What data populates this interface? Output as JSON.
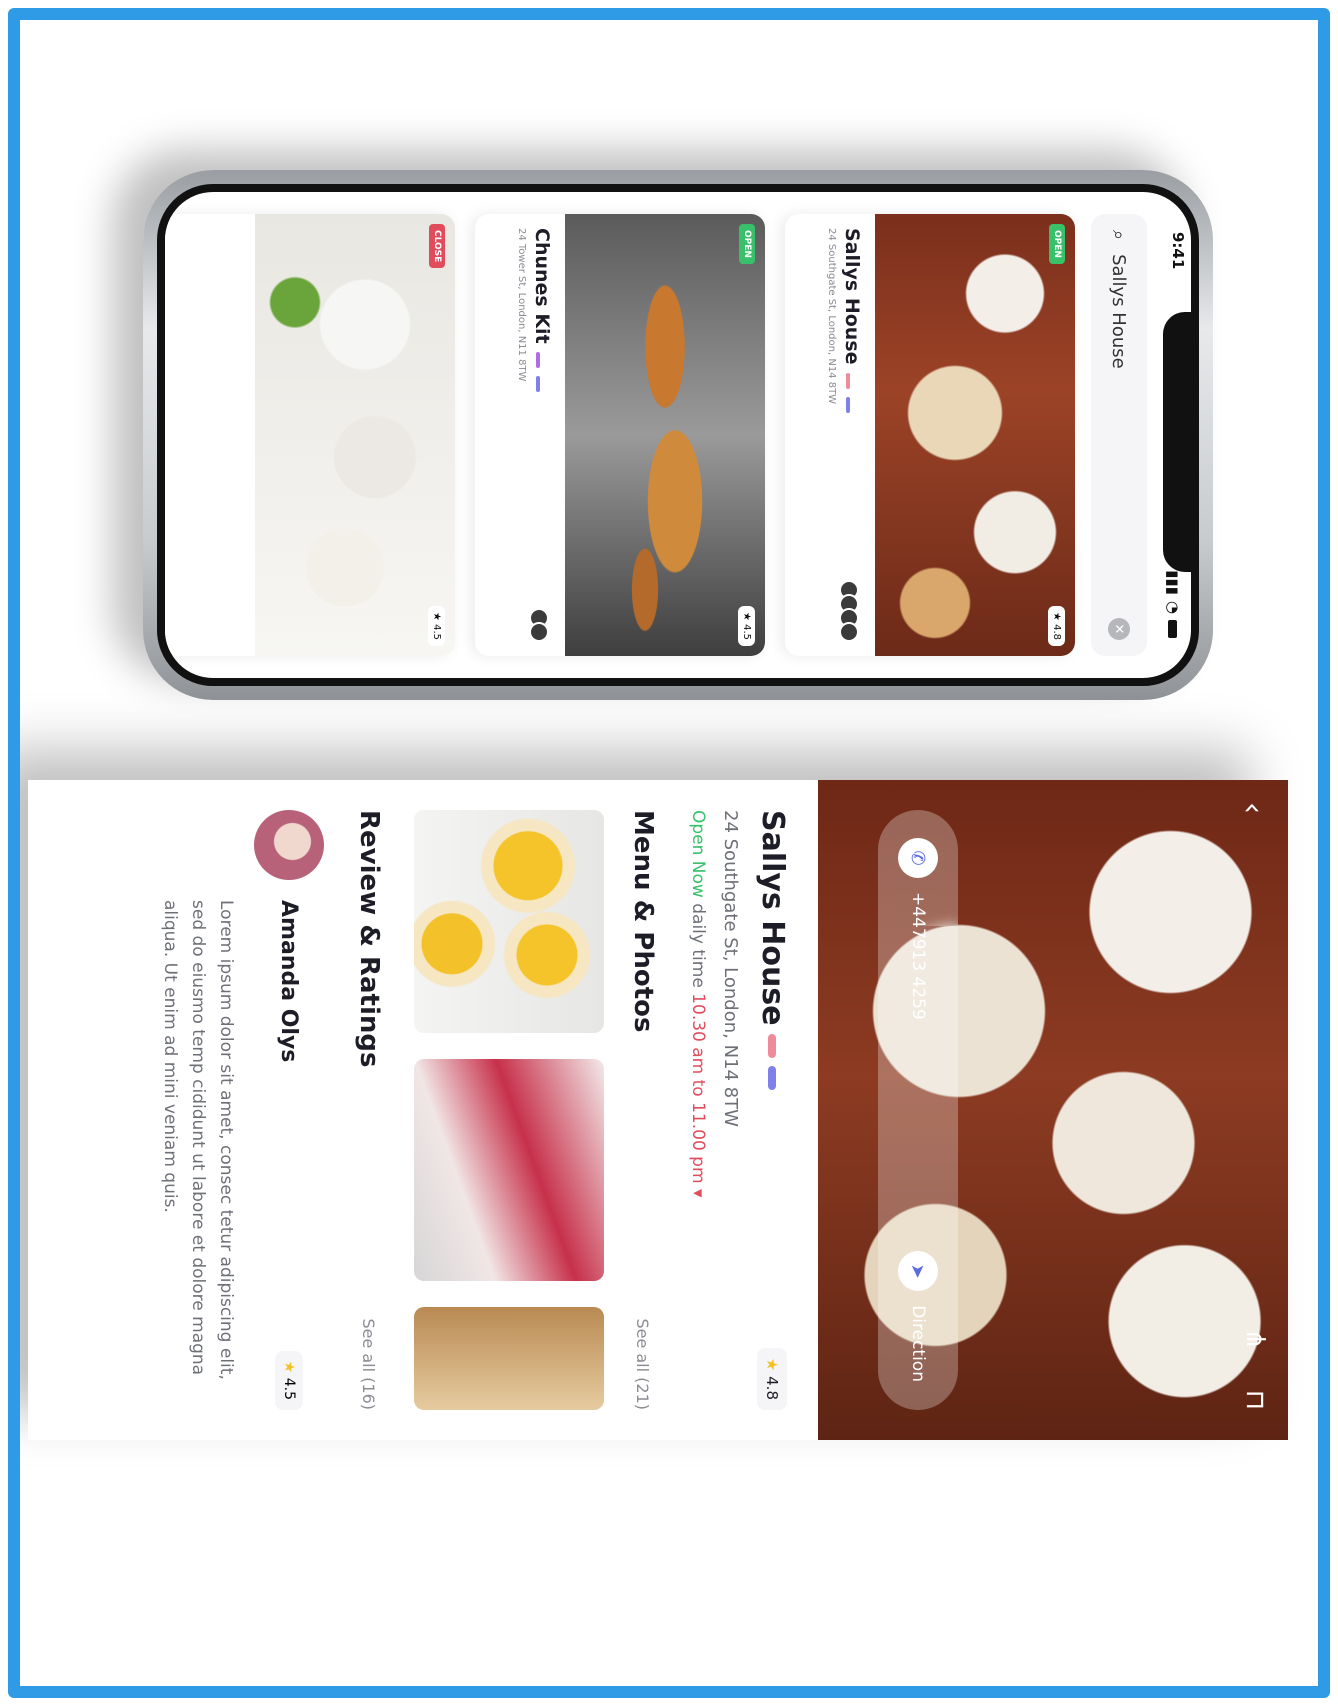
{
  "status": {
    "time": "9:41"
  },
  "search": {
    "query": "Sallys House"
  },
  "list": [
    {
      "name": "Sallys House",
      "address": "24 Southgate St, London, N14 8TW",
      "tag": "OPEN",
      "rating": "4.8"
    },
    {
      "name": "Chunes Kit",
      "address": "24 Tower St, London, N11 8TW",
      "tag": "OPEN",
      "rating": "4.5"
    },
    {
      "name": "",
      "address": "",
      "tag": "CLOSE",
      "rating": "4.5"
    }
  ],
  "detail": {
    "name": "Sallys House",
    "rating": "4.8",
    "address": "24 Southgate St, London, N14 8TW",
    "open_label": "Open Now",
    "hours_label": "daily time",
    "hours": "10.30 am to 11.00 pm",
    "phone": "+447913 4259",
    "direction": "Direction",
    "menu_title": "Menu & Photos",
    "menu_see_all": "See all (21)",
    "review_title": "Review & Ratings",
    "review_see_all": "See all (16)",
    "reviewer_name": "Amanda Olys",
    "reviewer_rating": "4.5",
    "review_text": "Lorem ipsum dolor sit amet, consec tetur adipiscing elit, sed do eiusmo temp cididunt ut labore et dolore magna aliqua. Ut enim ad mini veniam quis."
  },
  "colors": {
    "frame": "#2f9ae6",
    "open": "#38c06a",
    "close": "#e14c5d",
    "accent": "#6c6ee6"
  }
}
